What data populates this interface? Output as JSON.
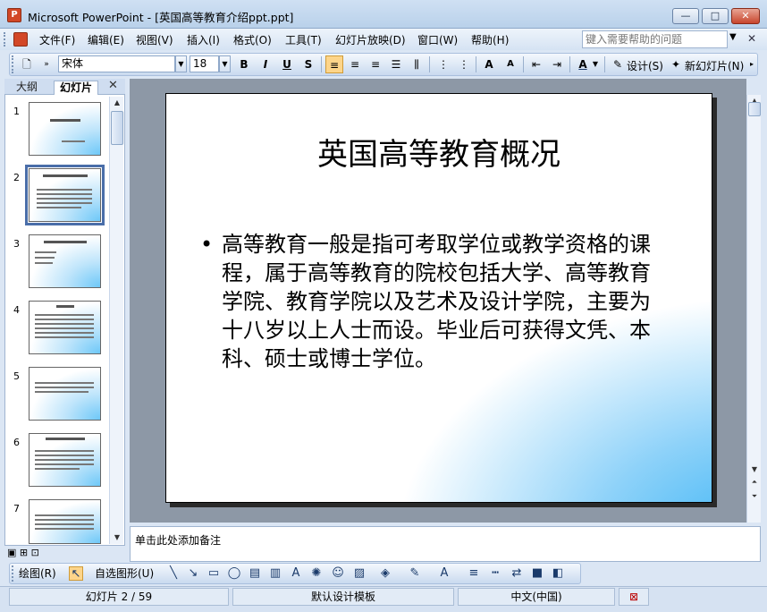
{
  "window": {
    "title": "Microsoft PowerPoint - [英国高等教育介绍ppt.ppt]",
    "min_glyph": "—",
    "max_glyph": "□",
    "close_glyph": "✕"
  },
  "menu": {
    "items": [
      "文件(F)",
      "编辑(E)",
      "视图(V)",
      "插入(I)",
      "格式(O)",
      "工具(T)",
      "幻灯片放映(D)",
      "窗口(W)",
      "帮助(H)"
    ],
    "help_placeholder": "键入需要帮助的问题"
  },
  "format_toolbar": {
    "font_name": "宋体",
    "font_size": "18",
    "bold": "B",
    "italic": "I",
    "underline": "U",
    "shadow": "S",
    "design_label": "设计(S)",
    "new_slide_label": "新幻灯片(N)"
  },
  "left_pane": {
    "tabs": [
      "大纲",
      "幻灯片"
    ],
    "close_glyph": "✕",
    "slide_numbers": [
      "1",
      "2",
      "3",
      "4",
      "5",
      "6",
      "7"
    ]
  },
  "slide": {
    "title": "英国高等教育概况",
    "bullet": "•",
    "body": "高等教育一般是指可考取学位或教学资格的课程，属于高等教育的院校包括大学、高等教育学院、教育学院以及艺术及设计学院，主要为十八岁以上人士而设。毕业后可获得文凭、本科、硕士或博士学位。"
  },
  "notes": {
    "placeholder": "单击此处添加备注"
  },
  "draw_toolbar": {
    "draw_label": "绘图(R)",
    "autoshape_label": "自选图形(U)"
  },
  "status": {
    "slide_info": "幻灯片 2 / 59",
    "template": "默认设计模板",
    "language": "中文(中国)"
  },
  "colors": {
    "accent": "#4a6ea9",
    "slide_gradient": "#39b3f5",
    "active_button": "#fdd58a"
  }
}
